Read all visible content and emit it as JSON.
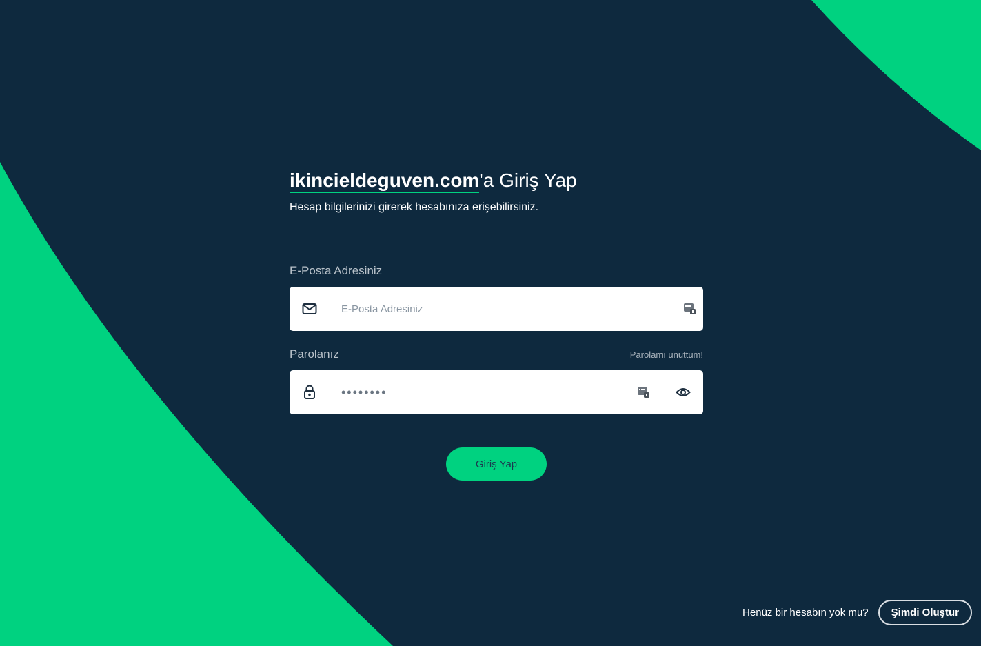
{
  "colors": {
    "background": "#0e293e",
    "accent": "#00d280",
    "input_bg": "#ffffff"
  },
  "login": {
    "title_brand": "ikincieldeguven.com",
    "title_suffix": "'a Giriş Yap",
    "subtitle": "Hesap bilgilerinizi girerek hesabınıza erişebilirsiniz.",
    "email": {
      "label": "E-Posta Adresiniz",
      "placeholder": "E-Posta Adresiniz",
      "value": "",
      "icon": "mail-icon"
    },
    "password": {
      "label": "Parolanız",
      "forgot_link": "Parolamı unuttum!",
      "masked_value": "••••••••",
      "icon": "lock-icon",
      "toggle_icon": "eye-icon"
    },
    "submit_label": "Giriş Yap"
  },
  "signup": {
    "prompt": "Henüz bir hesabın yok mu?",
    "button_label": "Şimdi Oluştur"
  }
}
